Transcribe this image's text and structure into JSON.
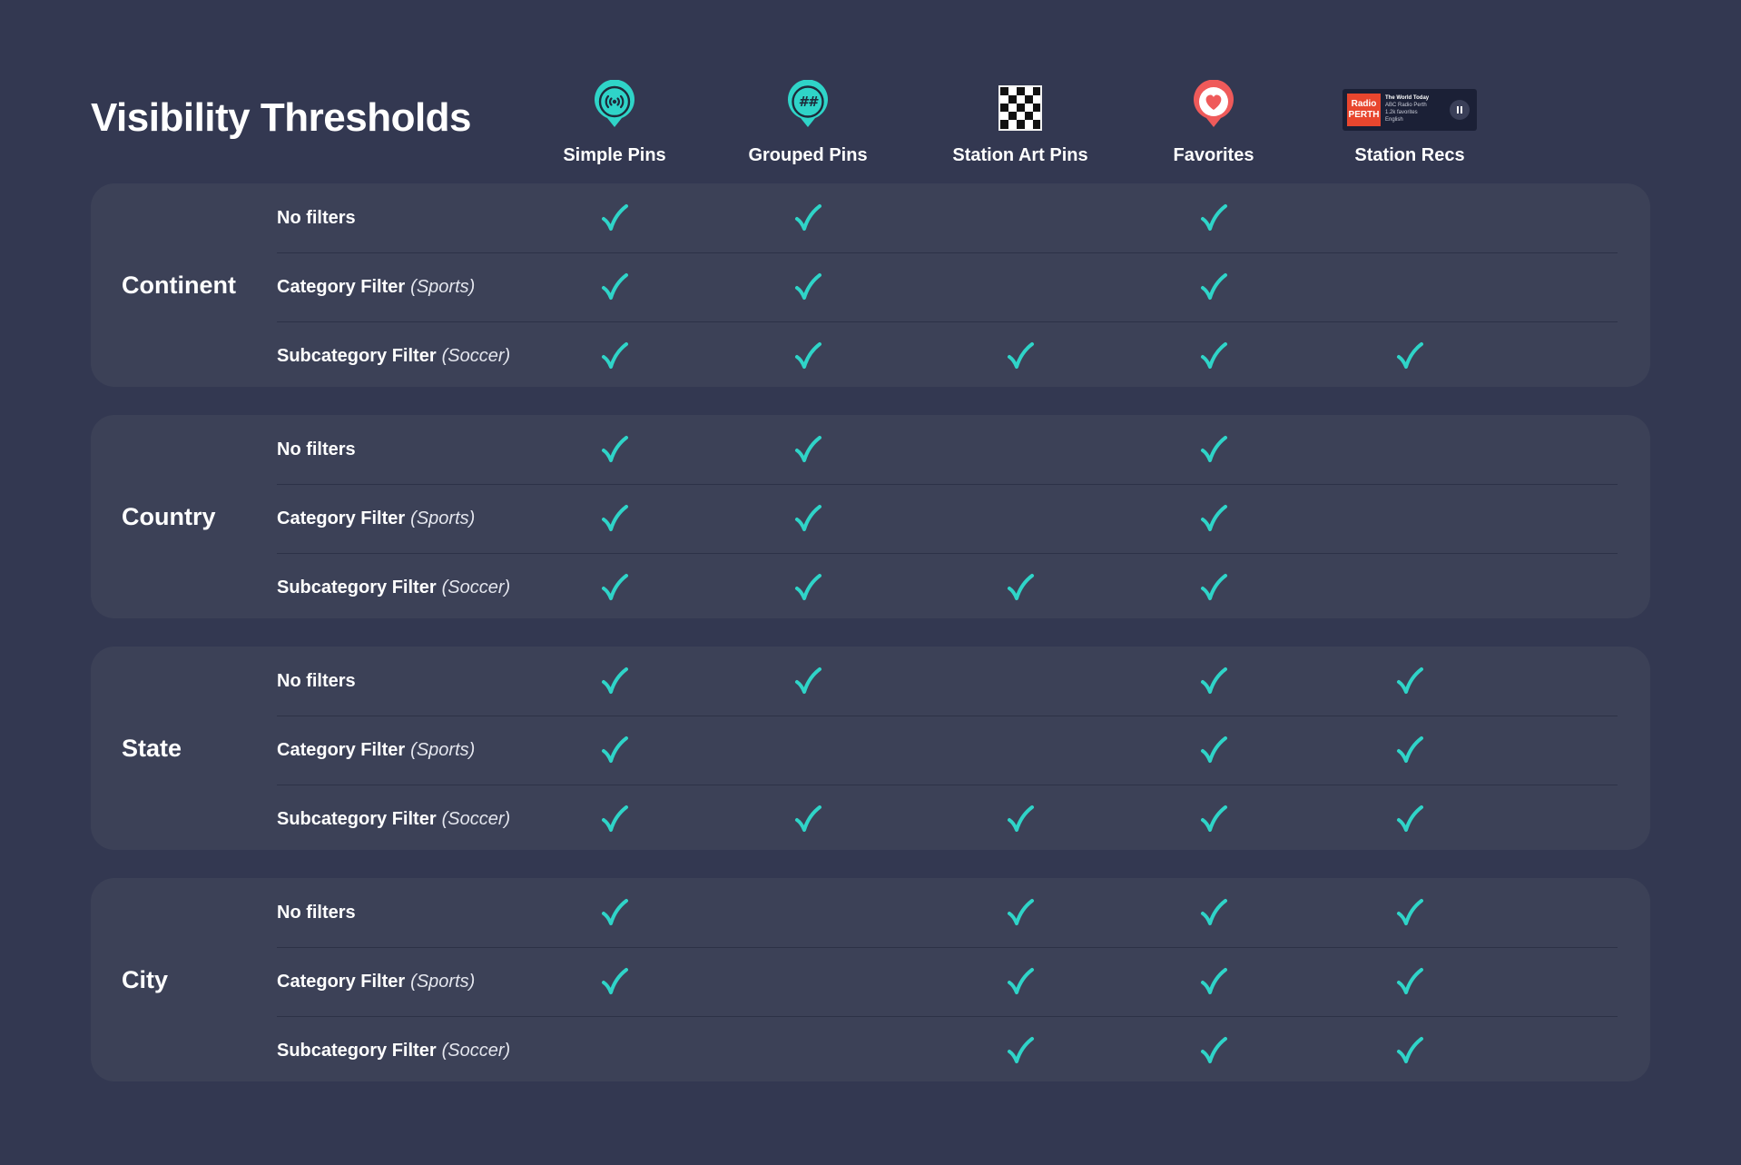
{
  "title": "Visibility Thresholds",
  "colors": {
    "background": "#333851",
    "panel": "#3c4157",
    "check": "#2fd4c8",
    "pin_teal": "#2fd4c8",
    "favorite_red": "#ef5a5a",
    "station_red": "#e8462e"
  },
  "columns": [
    {
      "label": "Simple Pins",
      "icon": "broadcast-pin-icon"
    },
    {
      "label": "Grouped Pins",
      "icon": "grouped-pin-icon",
      "icon_text": "##"
    },
    {
      "label": "Station Art Pins",
      "icon": "checkerboard-pin-icon"
    },
    {
      "label": "Favorites",
      "icon": "heart-pin-icon"
    },
    {
      "label": "Station Recs",
      "icon": "station-card-icon"
    }
  ],
  "station_card": {
    "art_text": "Radio PERTH",
    "title": "The World Today",
    "station": "ABC Radio Perth",
    "favorites": "1.2k favorites",
    "language": "English"
  },
  "filters": {
    "none": "No filters",
    "category": "Category Filter",
    "category_example": "(Sports)",
    "subcategory": "Subcategory Filter",
    "subcategory_example": "(Soccer)"
  },
  "sections": [
    {
      "label": "Continent",
      "rows": [
        [
          true,
          true,
          false,
          true,
          false
        ],
        [
          true,
          true,
          false,
          true,
          false
        ],
        [
          true,
          true,
          true,
          true,
          true
        ]
      ]
    },
    {
      "label": "Country",
      "rows": [
        [
          true,
          true,
          false,
          true,
          false
        ],
        [
          true,
          true,
          false,
          true,
          false
        ],
        [
          true,
          true,
          true,
          true,
          false
        ]
      ]
    },
    {
      "label": "State",
      "rows": [
        [
          true,
          true,
          false,
          true,
          true
        ],
        [
          true,
          false,
          false,
          true,
          true
        ],
        [
          true,
          true,
          true,
          true,
          true
        ]
      ]
    },
    {
      "label": "City",
      "rows": [
        [
          true,
          false,
          true,
          true,
          true
        ],
        [
          true,
          false,
          true,
          true,
          true
        ],
        [
          false,
          false,
          true,
          true,
          true
        ]
      ]
    }
  ]
}
